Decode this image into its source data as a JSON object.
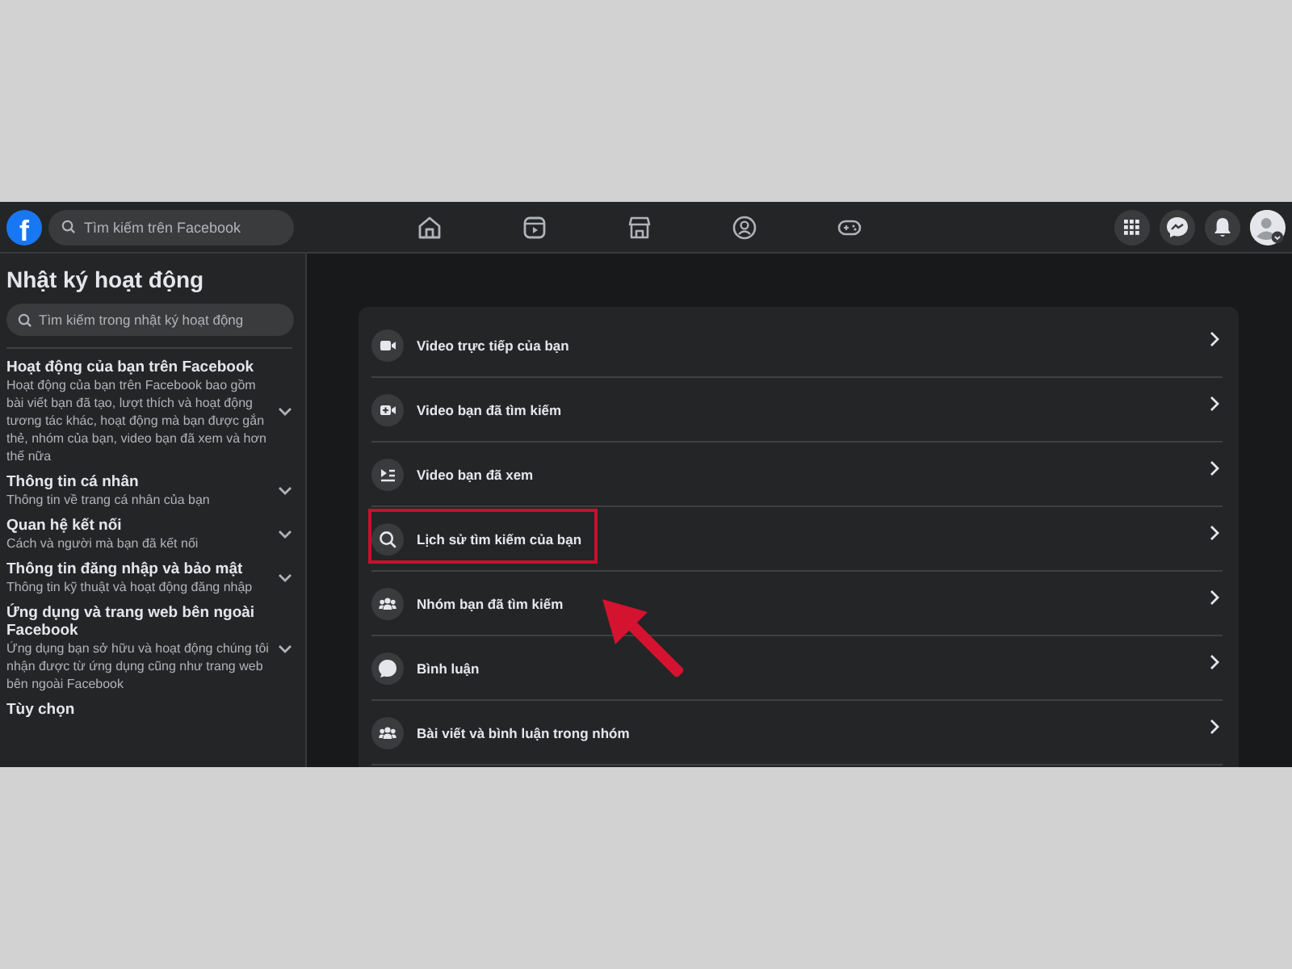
{
  "header": {
    "logo": "f",
    "search": {
      "placeholder": "Tìm kiếm trên Facebook"
    },
    "nav": [
      {
        "kind": "home"
      },
      {
        "kind": "video"
      },
      {
        "kind": "store"
      },
      {
        "kind": "groups"
      },
      {
        "kind": "gaming"
      }
    ],
    "actions": [
      {
        "kind": "menu"
      },
      {
        "kind": "messenger"
      },
      {
        "kind": "bell"
      }
    ]
  },
  "sidebar": {
    "title": "Nhật ký hoạt động",
    "search": {
      "placeholder": "Tìm kiếm trong nhật ký hoạt động"
    },
    "sections": [
      {
        "title": "Hoạt động của bạn trên Facebook",
        "description": "Hoạt động của bạn trên Facebook bao gồm bài viết bạn đã tạo, lượt thích và hoạt động tương tác khác, hoạt động mà bạn được gắn thẻ, nhóm của bạn, video bạn đã xem và hơn thế nữa"
      },
      {
        "title": "Thông tin cá nhân",
        "description": "Thông tin về trang cá nhân của bạn"
      },
      {
        "title": "Quan hệ kết nối",
        "description": "Cách và người mà bạn đã kết nối"
      },
      {
        "title": "Thông tin đăng nhập và bảo mật",
        "description": "Thông tin kỹ thuật và hoạt động đăng nhập"
      },
      {
        "title": "Ứng dụng và trang web bên ngoài Facebook",
        "description": "Ứng dụng bạn sở hữu và hoạt động chúng tôi nhận được từ ứng dụng cũng như trang web bên ngoài Facebook"
      },
      {
        "title": "Tùy chọn"
      }
    ]
  },
  "main": {
    "items": [
      {
        "kind": "live-video",
        "label": "Video trực tiếp của bạn",
        "highlighted": false
      },
      {
        "kind": "video-search",
        "label": "Video bạn đã tìm kiếm",
        "highlighted": false
      },
      {
        "kind": "video-list",
        "label": "Video bạn đã xem",
        "highlighted": false
      },
      {
        "kind": "search",
        "label": "Lịch sử tìm kiếm của bạn",
        "highlighted": true
      },
      {
        "kind": "group",
        "label": "Nhóm bạn đã tìm kiếm",
        "highlighted": false
      },
      {
        "kind": "comment",
        "label": "Bình luận",
        "highlighted": false
      },
      {
        "kind": "group",
        "label": "Bài viết và bình luận trong nhóm",
        "highlighted": false
      }
    ]
  }
}
